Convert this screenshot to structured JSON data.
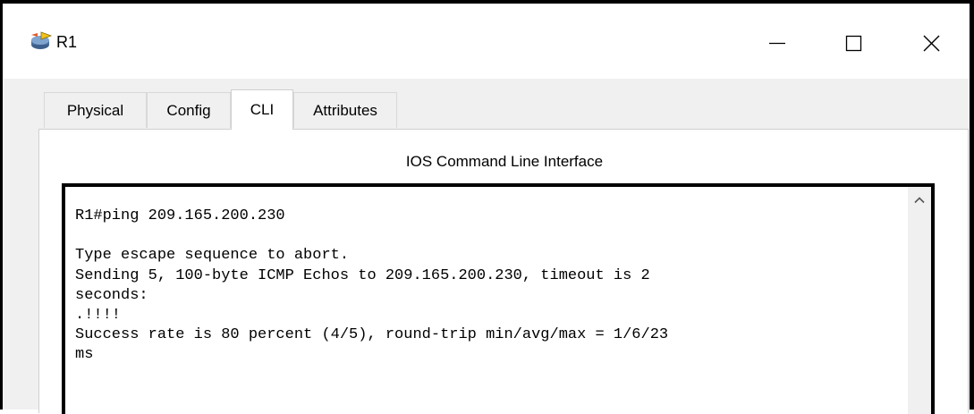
{
  "window": {
    "title": "R1",
    "icon": "router-icon",
    "controls": {
      "minimize_icon": "minimize-icon",
      "maximize_icon": "maximize-icon",
      "close_icon": "close-icon"
    }
  },
  "tabs": [
    {
      "label": "Physical",
      "active": false
    },
    {
      "label": "Config",
      "active": false
    },
    {
      "label": "CLI",
      "active": true
    },
    {
      "label": "Attributes",
      "active": false
    }
  ],
  "cli": {
    "panel_title": "IOS Command Line Interface",
    "lines": [
      "R1#ping 209.165.200.230",
      "",
      "Type escape sequence to abort.",
      "Sending 5, 100-byte ICMP Echos to 209.165.200.230, timeout is 2",
      "seconds:",
      ".!!!!",
      "Success rate is 80 percent (4/5), round-trip min/avg/max = 1/6/23",
      "ms"
    ]
  },
  "colors": {
    "titlebar_bg": "#ffffff",
    "window_bg": "#f0f0f0",
    "terminal_border": "#000000",
    "text": "#000000"
  }
}
